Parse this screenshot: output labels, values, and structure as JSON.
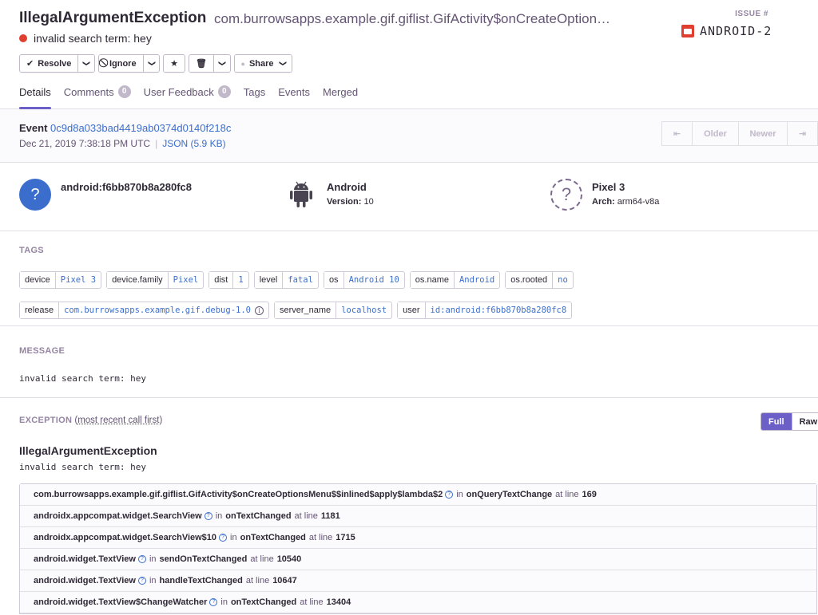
{
  "header": {
    "title": "IllegalArgumentException",
    "culprit": "com.burrowsapps.example.gif.giflist.GifActivity$onCreateOption…",
    "message": "invalid search term: hey",
    "issue_label": "ISSUE #",
    "issue_id": "ANDROID-2"
  },
  "actions": {
    "resolve": "Resolve",
    "ignore": "Ignore",
    "share": "Share"
  },
  "tabs": [
    {
      "label": "Details"
    },
    {
      "label": "Comments",
      "count": "0"
    },
    {
      "label": "User Feedback",
      "count": "0"
    },
    {
      "label": "Tags"
    },
    {
      "label": "Events"
    },
    {
      "label": "Merged"
    }
  ],
  "event": {
    "label": "Event",
    "id": "0c9d8a033bad4419ab0374d0140f218c",
    "date": "Dec 21, 2019 7:38:18 PM UTC",
    "json": "JSON (5.9 KB)",
    "older": "Older",
    "newer": "Newer"
  },
  "context": {
    "user": {
      "title": "android:f6bb870b8a280fc8"
    },
    "os": {
      "title": "Android",
      "sub_label": "Version:",
      "sub_value": "10"
    },
    "device": {
      "title": "Pixel 3",
      "sub_label": "Arch:",
      "sub_value": "arm64-v8a"
    }
  },
  "tags_section": {
    "label": "TAGS",
    "tags": [
      {
        "key": "device",
        "value": "Pixel 3"
      },
      {
        "key": "device.family",
        "value": "Pixel"
      },
      {
        "key": "dist",
        "value": "1"
      },
      {
        "key": "level",
        "value": "fatal"
      },
      {
        "key": "os",
        "value": "Android 10"
      },
      {
        "key": "os.name",
        "value": "Android"
      },
      {
        "key": "os.rooted",
        "value": "no"
      },
      {
        "key": "release",
        "value": "com.burrowsapps.example.gif.debug-1.0"
      },
      {
        "key": "server_name",
        "value": "localhost"
      },
      {
        "key": "user",
        "value": "id:android:f6bb870b8a280fc8"
      }
    ]
  },
  "message_section": {
    "label": "MESSAGE",
    "text": "invalid search term: hey"
  },
  "exception": {
    "label": "EXCEPTION",
    "label_suffix": "most recent call first",
    "toggle_full": "Full",
    "toggle_raw": "Raw",
    "type": "IllegalArgumentException",
    "value": "invalid search term: hey",
    "in_word": "in",
    "at_word": "at line",
    "frames": [
      {
        "module": "com.burrowsapps.example.gif.giflist.GifActivity$onCreateOptionsMenu$$inlined$apply$lambda$2",
        "function": "onQueryTextChange",
        "line": "169"
      },
      {
        "module": "androidx.appcompat.widget.SearchView",
        "function": "onTextChanged",
        "line": "1181"
      },
      {
        "module": "androidx.appcompat.widget.SearchView$10",
        "function": "onTextChanged",
        "line": "1715"
      },
      {
        "module": "android.widget.TextView",
        "function": "sendOnTextChanged",
        "line": "10540"
      },
      {
        "module": "android.widget.TextView",
        "function": "handleTextChanged",
        "line": "10647"
      },
      {
        "module": "android.widget.TextView$ChangeWatcher",
        "function": "onTextChanged",
        "line": "13404"
      }
    ]
  },
  "colors": {
    "accent": "#6c5fc7",
    "link": "#3b6ecc",
    "error": "#e03e2f"
  }
}
